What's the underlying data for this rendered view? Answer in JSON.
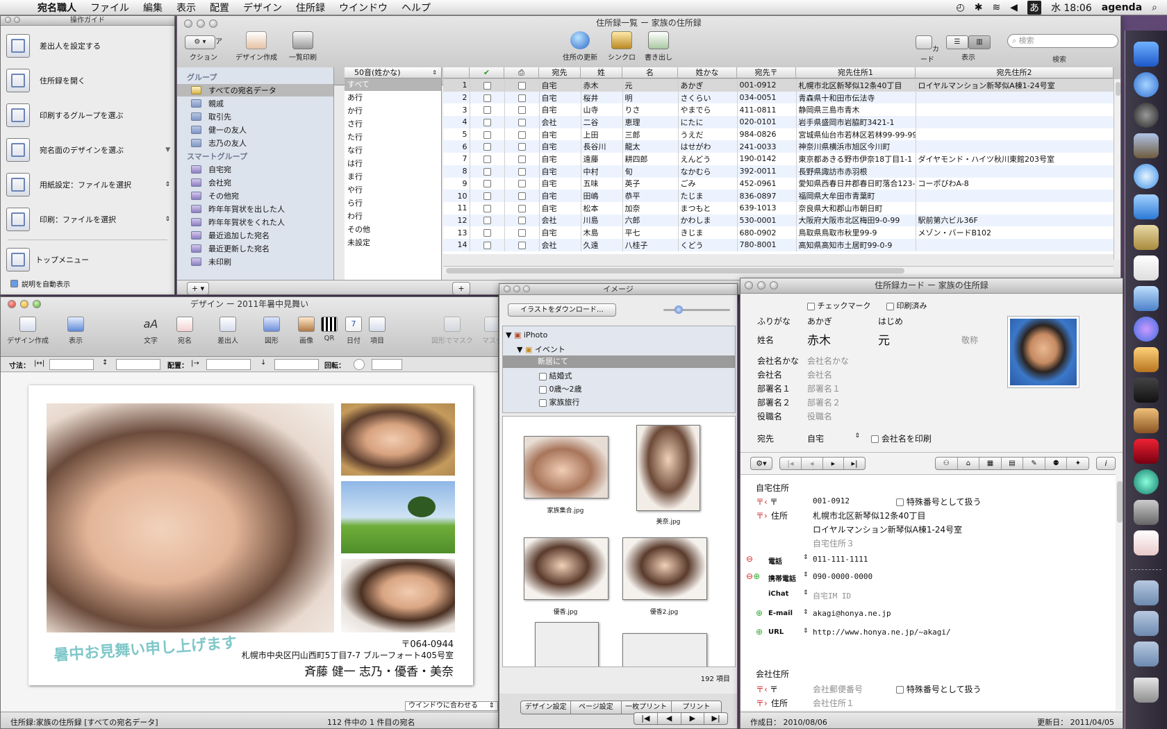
{
  "menubar": {
    "app": "宛名職人",
    "items": [
      "ファイル",
      "編集",
      "表示",
      "配置",
      "デザイン",
      "住所録",
      "ウインドウ",
      "ヘルプ"
    ],
    "clock": "水 18:06",
    "user": "agenda",
    "ime": "あ"
  },
  "guide": {
    "title": "操作ガイド",
    "items": [
      "差出人を設定する",
      "住所録を開く",
      "印刷するグループを選ぶ",
      "宛名面のデザインを選ぶ",
      "用紙設定：ファイルを選択",
      "印刷：ファイルを選択"
    ],
    "top_menu": "トップメニュー",
    "auto_show": "説明を自動表示"
  },
  "list": {
    "title": "住所録一覧 ー 家族の住所録",
    "toolbar": {
      "action": "アクション",
      "design": "デザイン作成",
      "print_list": "一覧印刷",
      "update": "住所の更新",
      "sync": "シンクロ",
      "export": "書き出し",
      "card": "カード",
      "view": "表示",
      "search": "検索",
      "search_placeholder": "検索"
    },
    "groups_header": "グループ",
    "groups": [
      "すべての宛名データ",
      "親戚",
      "取引先",
      "健一の友人",
      "志乃の友人"
    ],
    "smart_header": "スマートグループ",
    "smart": [
      "自宅宛",
      "会社宛",
      "その他宛",
      "昨年年賀状を出した人",
      "昨年年賀状をくれた人",
      "最近追加した宛名",
      "最近更新した宛名",
      "未印刷"
    ],
    "sort": "50音(姓かな)",
    "kana": [
      "すべて",
      "あ行",
      "か行",
      "さ行",
      "た行",
      "な行",
      "は行",
      "ま行",
      "や行",
      "ら行",
      "わ行",
      "その他",
      "未設定"
    ],
    "columns": [
      "",
      "",
      "",
      "宛先",
      "姓",
      "名",
      "姓かな",
      "宛先〒",
      "宛先住所1",
      "宛先住所2"
    ],
    "rows": [
      [
        "1",
        "自宅",
        "赤木",
        "元",
        "あかぎ",
        "001-0912",
        "札幌市北区新琴似12条40丁目",
        "ロイヤルマンション新琴似A棟1-24号室"
      ],
      [
        "2",
        "自宅",
        "桜井",
        "明",
        "さくらい",
        "034-0051",
        "青森県十和田市伝法寺",
        ""
      ],
      [
        "3",
        "自宅",
        "山寺",
        "りさ",
        "やまでら",
        "411-0811",
        "静岡県三島市青木",
        ""
      ],
      [
        "4",
        "会社",
        "二谷",
        "恵理",
        "にたに",
        "020-0101",
        "岩手県盛岡市岩脇町3421-1",
        ""
      ],
      [
        "5",
        "自宅",
        "上田",
        "三郎",
        "うえだ",
        "984-0826",
        "宮城県仙台市若林区若林99-99-99",
        ""
      ],
      [
        "6",
        "自宅",
        "長谷川",
        "龍太",
        "はせがわ",
        "241-0033",
        "神奈川県横浜市旭区今川町",
        ""
      ],
      [
        "7",
        "自宅",
        "遠藤",
        "耕四郎",
        "えんどう",
        "190-0142",
        "東京都あきる野市伊奈18丁目1-1",
        "ダイヤモンド・ハイツ秋川東館203号室"
      ],
      [
        "8",
        "自宅",
        "中村",
        "旬",
        "なかむら",
        "392-0011",
        "長野県諏訪市赤羽根",
        ""
      ],
      [
        "9",
        "自宅",
        "五味",
        "英子",
        "ごみ",
        "452-0961",
        "愛知県西春日井郡春日町落合123-4",
        "コーポびわA-8"
      ],
      [
        "10",
        "自宅",
        "田嶋",
        "恭平",
        "たじま",
        "836-0897",
        "福岡県大牟田市青葉町",
        ""
      ],
      [
        "11",
        "自宅",
        "松本",
        "加奈",
        "まつもと",
        "639-1013",
        "奈良県大和郡山市朝日町",
        ""
      ],
      [
        "12",
        "会社",
        "川島",
        "六郎",
        "かわしま",
        "530-0001",
        "大阪府大阪市北区梅田9-0-99",
        "駅前第六ビル36F"
      ],
      [
        "13",
        "自宅",
        "木島",
        "平七",
        "きじま",
        "680-0902",
        "鳥取県鳥取市秋里99-9",
        "メゾン・バードB102"
      ],
      [
        "14",
        "会社",
        "久遠",
        "八桂子",
        "くどう",
        "780-8001",
        "高知県高知市土居町99-0-9",
        ""
      ]
    ]
  },
  "design": {
    "title": "デザイン ー 2011年暑中見舞い",
    "toolbar": [
      "デザイン作成",
      "表示",
      "文字",
      "宛名",
      "差出人",
      "図形",
      "画像",
      "QR",
      "日付",
      "項目",
      "図形でマスク",
      "マスク"
    ],
    "size_label": "寸法：",
    "align_label": "配置：",
    "rotate_label": "回転：",
    "card": {
      "greeting": "暑中お見舞い申し上げます",
      "zip": "〒064-0944",
      "address": "札幌市中央区円山西町5丁目7-7 ブルーフォート405号室",
      "names": "斉藤 健一 志乃・優香・美奈"
    },
    "fit": "ウインドウに合わせる",
    "status_left": "住所録:家族の住所録 [すべての宛名データ]",
    "status_center": "112 件中の 1 件目の宛名"
  },
  "image": {
    "title": "イメージ",
    "download": "イラストをダウンロード…",
    "tree": [
      "iPhoto",
      "イベント",
      "新居にて",
      "結婚式",
      "0歳〜2歳",
      "家族旅行"
    ],
    "thumbs": [
      "家族集合.jpg",
      "美奈.jpg",
      "優香.jpg",
      "優香2.jpg"
    ],
    "count": "192 項目",
    "buttons": [
      "デザイン設定",
      "ページ設定",
      "一枚プリント",
      "プリント"
    ]
  },
  "card": {
    "title": "住所録カード ー 家族の住所録",
    "check_mark": "チェックマーク",
    "printed": "印刷済み",
    "furigana_label": "ふりがな",
    "furigana_last": "あかぎ",
    "furigana_first": "はじめ",
    "name_label": "姓名",
    "last": "赤木",
    "first": "元",
    "honorific": "敬称",
    "company_kana_label": "会社名かな",
    "company_kana": "会社名かな",
    "company_label": "会社名",
    "company": "会社名",
    "dept1_label": "部署名１",
    "dept1": "部署名１",
    "dept2_label": "部署名２",
    "dept2": "部署名２",
    "title_label": "役職名",
    "title_ph": "役職名",
    "dest_label": "宛先",
    "dest": "自宅",
    "print_company": "会社名を印刷",
    "home_label": "自宅住所",
    "zip_label": "〒",
    "zip": "001-0912",
    "special": "特殊番号として扱う",
    "addr_label": "住所",
    "addr1": "札幌市北区新琴似12条40丁目",
    "addr2": "ロイヤルマンション新琴似A棟1-24号室",
    "addr3": "自宅住所３",
    "phone_label": "電話",
    "phone": "011-111-1111",
    "mobile_label": "携帯電話",
    "mobile": "090-0000-0000",
    "ichat_label": "iChat",
    "ichat": "自宅IM ID",
    "email_label": "E-mail",
    "email": "akagi@honya.ne.jp",
    "url_label": "URL",
    "url": "http://www.honya.ne.jp/~akagi/",
    "work_label": "会社住所",
    "work_zip": "会社郵便番号",
    "work_addr": "会社住所１",
    "created": "作成日： 2010/08/06",
    "updated": "更新日： 2011/04/05"
  }
}
